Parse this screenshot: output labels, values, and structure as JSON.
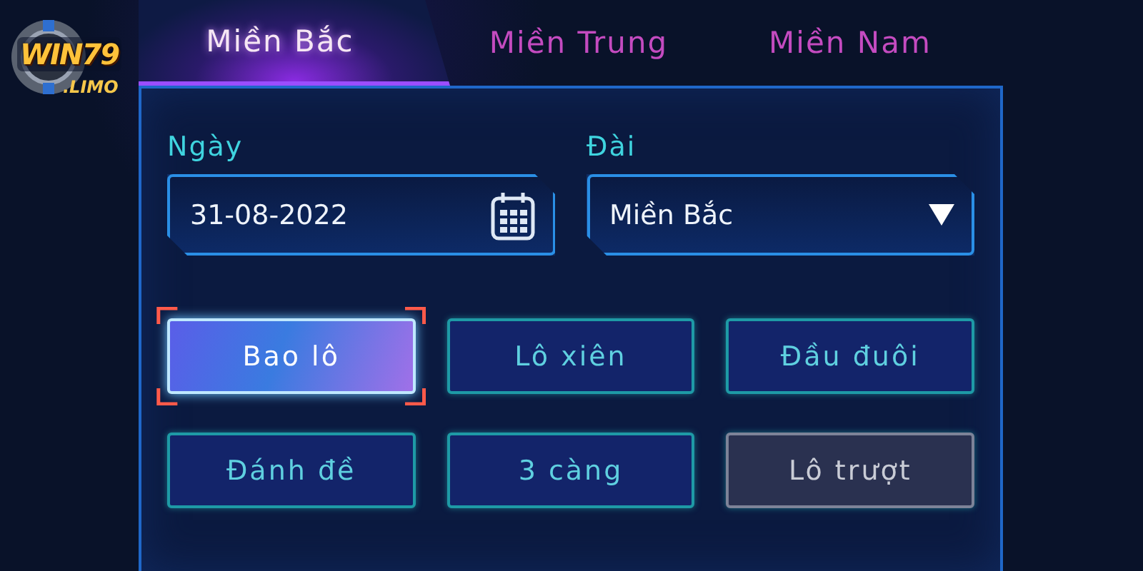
{
  "logo": {
    "name": "WIN79",
    "domain": ".LIMO"
  },
  "tabs": [
    {
      "label": "Miền Bắc",
      "selected": true
    },
    {
      "label": "Miền Trung",
      "selected": false
    },
    {
      "label": "Miền Nam",
      "selected": false
    }
  ],
  "date_field": {
    "label": "Ngày",
    "value": "31-08-2022"
  },
  "station_field": {
    "label": "Đài",
    "value": "Miền Bắc"
  },
  "bet_types": [
    {
      "label": "Bao lô",
      "selected": true,
      "disabled": false
    },
    {
      "label": "Lô xiên",
      "selected": false,
      "disabled": false
    },
    {
      "label": "Đầu đuôi",
      "selected": false,
      "disabled": false
    },
    {
      "label": "Đánh đề",
      "selected": false,
      "disabled": false
    },
    {
      "label": "3 càng",
      "selected": false,
      "disabled": false
    },
    {
      "label": "Lô trượt",
      "selected": false,
      "disabled": true
    }
  ]
}
